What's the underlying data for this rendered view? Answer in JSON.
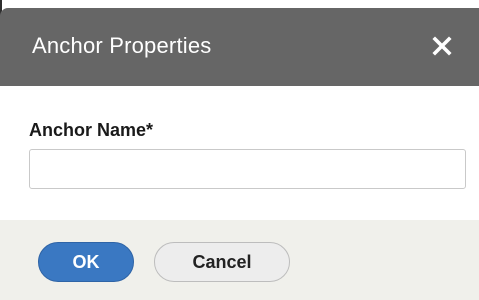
{
  "dialog": {
    "title": "Anchor Properties",
    "close_icon": "close-icon"
  },
  "form": {
    "anchor_name_label": "Anchor Name*",
    "anchor_name_value": "",
    "anchor_name_placeholder": ""
  },
  "footer": {
    "ok_label": "OK",
    "cancel_label": "Cancel"
  },
  "colors": {
    "header_bg": "#666666",
    "ok_button": "#3a78c2",
    "footer_bg": "#f0f0eb"
  }
}
